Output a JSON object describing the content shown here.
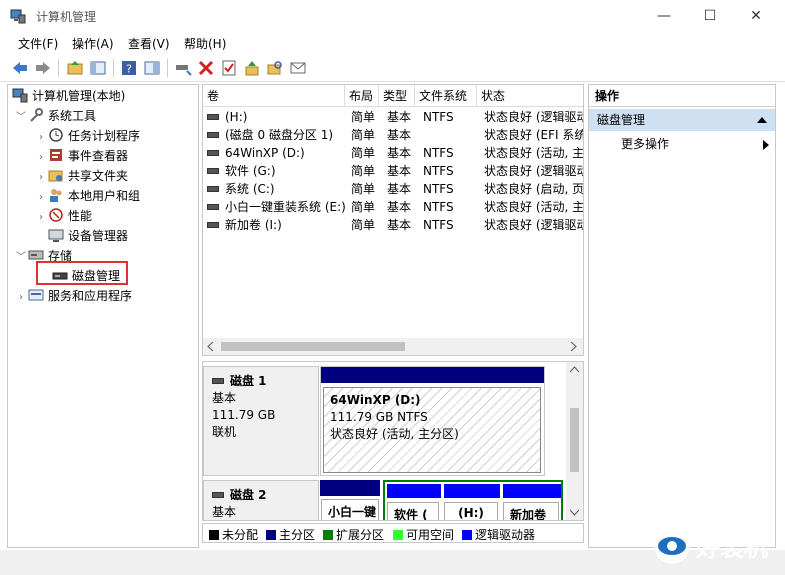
{
  "window": {
    "title": "计算机管理"
  },
  "menu": [
    "文件(F)",
    "操作(A)",
    "查看(V)",
    "帮助(H)"
  ],
  "tree": {
    "root": "计算机管理(本地)",
    "system_tools": "系统工具",
    "task_scheduler": "任务计划程序",
    "event_viewer": "事件查看器",
    "shared_folders": "共享文件夹",
    "local_users": "本地用户和组",
    "performance": "性能",
    "device_manager": "设备管理器",
    "storage": "存储",
    "disk_management": "磁盘管理",
    "services": "服务和应用程序"
  },
  "volume_list": {
    "columns": [
      "卷",
      "布局",
      "类型",
      "文件系统",
      "状态"
    ],
    "rows": [
      [
        "(H:)",
        "简单",
        "基本",
        "NTFS",
        "状态良好 (逻辑驱动"
      ],
      [
        "(磁盘 0 磁盘分区 1)",
        "简单",
        "基本",
        "",
        "状态良好 (EFI 系统"
      ],
      [
        "64WinXP  (D:)",
        "简单",
        "基本",
        "NTFS",
        "状态良好 (活动, 主"
      ],
      [
        "软件 (G:)",
        "简单",
        "基本",
        "NTFS",
        "状态良好 (逻辑驱动"
      ],
      [
        "系统 (C:)",
        "简单",
        "基本",
        "NTFS",
        "状态良好 (启动, 页"
      ],
      [
        "小白一键重装系统 (E:)",
        "简单",
        "基本",
        "NTFS",
        "状态良好 (活动, 主"
      ],
      [
        "新加卷 (I:)",
        "简单",
        "基本",
        "NTFS",
        "状态良好 (逻辑驱动"
      ]
    ]
  },
  "disks": {
    "disk1": {
      "name": "磁盘 1",
      "type": "基本",
      "size": "111.79 GB",
      "status": "联机",
      "partition": {
        "name": "64WinXP   (D:)",
        "size": "111.79 GB NTFS",
        "status": "状态良好 (活动, 主分区)"
      }
    },
    "disk2": {
      "name": "磁盘 2",
      "type": "基本",
      "partitions": [
        "小白一键",
        "软件 (",
        "(H:)",
        "新加卷"
      ]
    }
  },
  "legend": [
    {
      "label": "未分配",
      "color": "#000000"
    },
    {
      "label": "主分区",
      "color": "#000080"
    },
    {
      "label": "扩展分区",
      "color": "#008000"
    },
    {
      "label": "可用空间",
      "color": "#30ff30"
    },
    {
      "label": "逻辑驱动器",
      "color": "#0000ff"
    }
  ],
  "actions": {
    "header": "操作",
    "section": "磁盘管理",
    "more": "更多操作"
  },
  "watermark": {
    "text": "好装机"
  },
  "colors": {
    "accent": "#000080",
    "selection_border": "#e03030",
    "action_section": "#cfe0f2"
  }
}
